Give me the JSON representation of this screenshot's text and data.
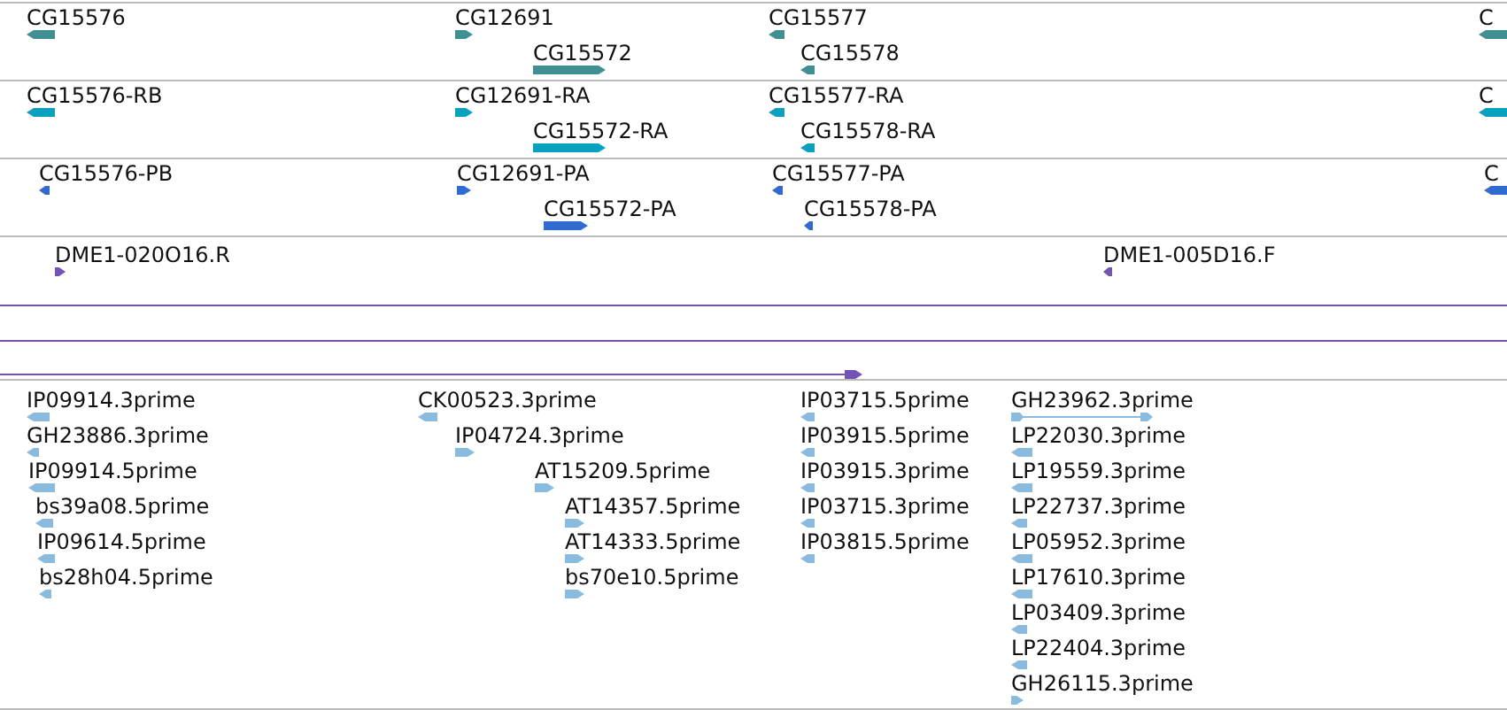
{
  "tracks": [
    {
      "color": "#3f8f93",
      "features": [
        {
          "label": "CG15576",
          "reverse": true
        },
        {
          "label": "CG12691",
          "reverse": false
        },
        {
          "label": "CG15572",
          "reverse": false
        },
        {
          "label": "CG15577",
          "reverse": true
        },
        {
          "label": "CG15578",
          "reverse": true
        },
        {
          "label": "C",
          "reverse": true
        }
      ]
    },
    {
      "color": "#0aa0c0",
      "features": [
        {
          "label": "CG15576-RB",
          "reverse": true
        },
        {
          "label": "CG12691-RA",
          "reverse": false
        },
        {
          "label": "CG15572-RA",
          "reverse": false
        },
        {
          "label": "CG15577-RA",
          "reverse": true
        },
        {
          "label": "CG15578-RA",
          "reverse": true
        },
        {
          "label": "C",
          "reverse": true
        }
      ]
    },
    {
      "color": "#2f6bd0",
      "features": [
        {
          "label": "CG15576-PB",
          "reverse": true
        },
        {
          "label": "CG12691-PA",
          "reverse": false
        },
        {
          "label": "CG15572-PA",
          "reverse": false
        },
        {
          "label": "CG15577-PA",
          "reverse": true
        },
        {
          "label": "CG15578-PA",
          "reverse": true
        },
        {
          "label": "C",
          "reverse": true
        }
      ]
    },
    {
      "color": "#7453b3",
      "features": [
        {
          "kind": "marker",
          "label": "DME1-020O16.R",
          "reverse": false
        },
        {
          "kind": "marker",
          "label": "DME1-005D16.F",
          "reverse": true
        },
        {
          "kind": "span",
          "arrowhead": false
        },
        {
          "kind": "span",
          "arrowhead": false
        },
        {
          "kind": "span",
          "arrowhead": true
        }
      ]
    },
    {
      "color": "#88bbdd",
      "features": [
        {
          "kind": "block",
          "label": "IP09914.3prime",
          "reverse": true
        },
        {
          "kind": "block",
          "label": "GH23886.3prime",
          "reverse": true
        },
        {
          "kind": "block",
          "label": "IP09914.5prime",
          "reverse": true
        },
        {
          "kind": "block",
          "label": "bs39a08.5prime",
          "reverse": true
        },
        {
          "kind": "block",
          "label": "IP09614.5prime",
          "reverse": true
        },
        {
          "kind": "block",
          "label": "bs28h04.5prime",
          "reverse": true
        },
        {
          "kind": "block",
          "label": "CK00523.3prime",
          "reverse": true
        },
        {
          "kind": "block",
          "label": "IP04724.3prime",
          "reverse": false
        },
        {
          "kind": "block",
          "label": "AT15209.5prime",
          "reverse": false
        },
        {
          "kind": "block",
          "label": "AT14357.5prime",
          "reverse": false
        },
        {
          "kind": "block",
          "label": "AT14333.5prime",
          "reverse": false
        },
        {
          "kind": "block",
          "label": "bs70e10.5prime",
          "reverse": false
        },
        {
          "kind": "block",
          "label": "IP03715.5prime",
          "reverse": true
        },
        {
          "kind": "block",
          "label": "IP03915.5prime",
          "reverse": true
        },
        {
          "kind": "block",
          "label": "IP03915.3prime",
          "reverse": true
        },
        {
          "kind": "block",
          "label": "IP03715.3prime",
          "reverse": true
        },
        {
          "kind": "block",
          "label": "IP03815.5prime",
          "reverse": true
        },
        {
          "kind": "linked",
          "label": "GH23962.3prime",
          "reverse": false
        },
        {
          "kind": "block",
          "label": "LP22030.3prime",
          "reverse": true
        },
        {
          "kind": "block",
          "label": "LP19559.3prime",
          "reverse": true
        },
        {
          "kind": "block",
          "label": "LP22737.3prime",
          "reverse": true
        },
        {
          "kind": "block",
          "label": "LP05952.3prime",
          "reverse": true
        },
        {
          "kind": "block",
          "label": "LP17610.3prime",
          "reverse": true
        },
        {
          "kind": "block",
          "label": "LP03409.3prime",
          "reverse": true
        },
        {
          "kind": "block",
          "label": "LP22404.3prime",
          "reverse": true
        },
        {
          "kind": "block",
          "label": "GH26115.3prime",
          "reverse": false
        }
      ]
    }
  ]
}
